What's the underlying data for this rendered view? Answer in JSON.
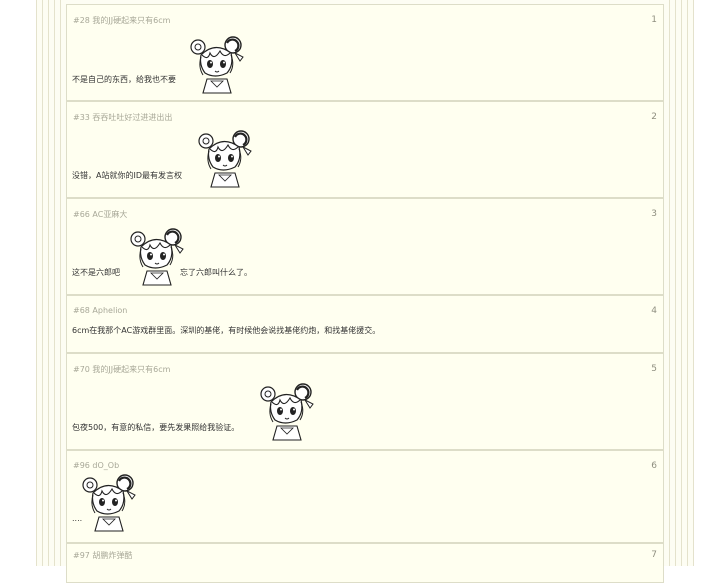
{
  "posts": [
    {
      "author": "#28 我的JJ硬起来只有6cm",
      "num": "1",
      "text": "不是自己的东西，给我也不要",
      "sticker": "ac-girl-sticker"
    },
    {
      "author": "#33 吞吞吐吐好过进进出出",
      "num": "2",
      "text": "没错，A站就你的ID最有发言权",
      "sticker": "ac-girl-sticker"
    },
    {
      "author": "#66 AC亚麻大",
      "num": "3",
      "text": "这不是六郎吧",
      "text2": "忘了六郎叫什么了。",
      "sticker": "ac-girl-sticker"
    },
    {
      "author": "#68 Aphelion",
      "num": "4",
      "text": "6cm在我那个AC游戏群里面。深圳的基佬，有时候他会说找基佬约炮，和找基佬援交。"
    },
    {
      "author": "#70 我的JJ硬起来只有6cm",
      "num": "5",
      "text": "包夜500，有意的私信，要先发果照给我验证。",
      "sticker": "ac-girl-sticker"
    },
    {
      "author": "#96 dO_Ob",
      "num": "6",
      "text": "....",
      "sticker": "ac-girl-sticker"
    },
    {
      "author": "#97 胡鹏炸弹酷",
      "num": "7"
    }
  ]
}
